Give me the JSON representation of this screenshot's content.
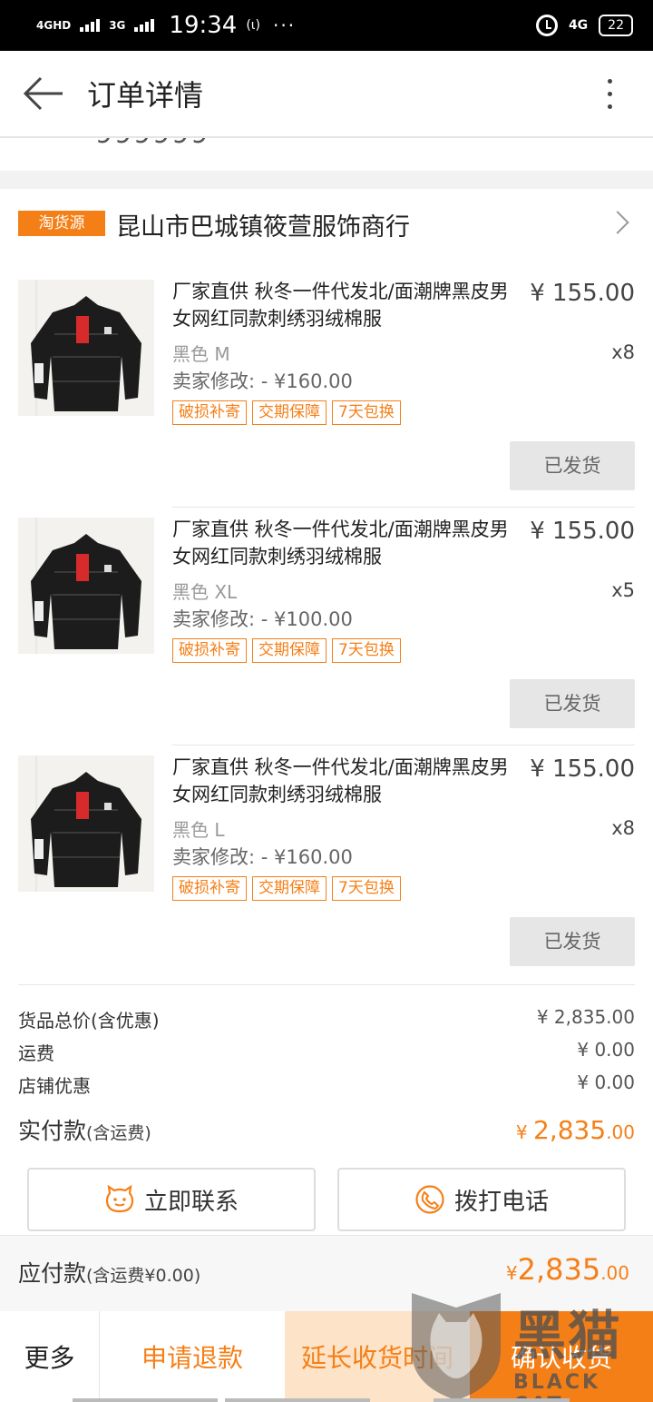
{
  "status_bar": {
    "network": [
      "4GHD",
      "3G"
    ],
    "time": "19:34",
    "hotspot": "(ι)",
    "dots": "···",
    "mobile": "4G",
    "battery": "22"
  },
  "header": {
    "title": "订单详情"
  },
  "cutoff_text": "999999",
  "shop": {
    "tag": "淘货源",
    "name": "昆山市巴城镇筱萱服饰商行"
  },
  "items": [
    {
      "title": "厂家直供  秋冬一件代发北/面潮牌黑皮男女网红同款刺绣羽绒棉服",
      "price": "¥ 155.00",
      "variant": "黑色 M",
      "qty": "x8",
      "seller_modify": "卖家修改: - ¥160.00",
      "badges": [
        "破损补寄",
        "交期保障",
        "7天包换"
      ],
      "status": "已发货"
    },
    {
      "title": "厂家直供  秋冬一件代发北/面潮牌黑皮男女网红同款刺绣羽绒棉服",
      "price": "¥ 155.00",
      "variant": "黑色 XL",
      "qty": "x5",
      "seller_modify": "卖家修改: - ¥100.00",
      "badges": [
        "破损补寄",
        "交期保障",
        "7天包换"
      ],
      "status": "已发货"
    },
    {
      "title": "厂家直供  秋冬一件代发北/面潮牌黑皮男女网红同款刺绣羽绒棉服",
      "price": "¥ 155.00",
      "variant": "黑色 L",
      "qty": "x8",
      "seller_modify": "卖家修改: - ¥160.00",
      "badges": [
        "破损补寄",
        "交期保障",
        "7天包换"
      ],
      "status": "已发货"
    }
  ],
  "summary": {
    "goods_total_label": "货品总价(含优惠)",
    "goods_total": "¥ 2,835.00",
    "shipping_label": "运费",
    "shipping": "¥ 0.00",
    "shop_discount_label": "店铺优惠",
    "shop_discount": "¥ 0.00",
    "paid_label": "实付款",
    "paid_note": "(含运费)",
    "paid_symbol": "¥ ",
    "paid_int": "2,835",
    "paid_cents": ".00"
  },
  "contact": {
    "chat": "立即联系",
    "call": "拨打电话"
  },
  "payable": {
    "label": "应付款",
    "note": "(含运费¥0.00)",
    "symbol": "¥",
    "int": "2,835",
    "cents": ".00"
  },
  "bottom_bar": {
    "more": "更多",
    "refund": "申请退款",
    "extend": "延长收货时间",
    "confirm": "确认收货"
  },
  "watermark": {
    "text": "黑猫",
    "sub": "BLACK CAT"
  },
  "colors": {
    "accent": "#f57f17",
    "accent_light": "#fde3c8",
    "disabled_btn": "#e6e6e6"
  }
}
